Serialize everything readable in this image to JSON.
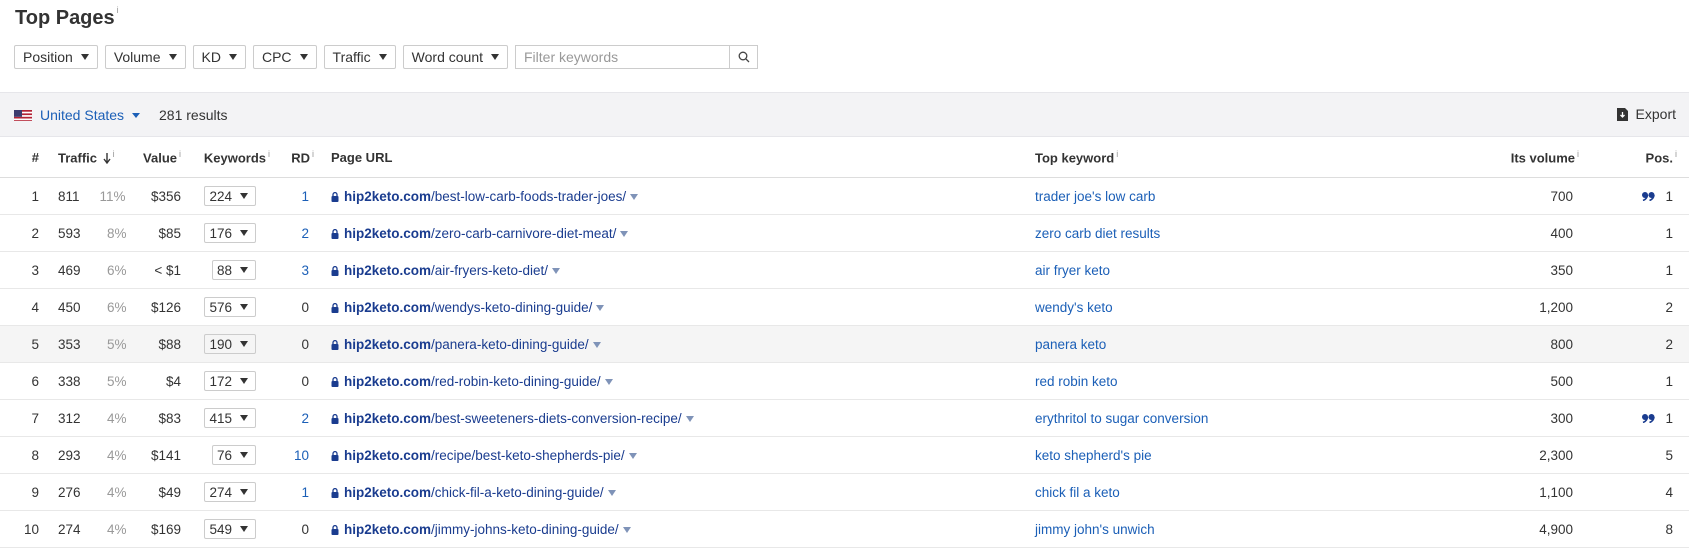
{
  "page": {
    "title": "Top Pages",
    "title_info": "i"
  },
  "filters": {
    "position": "Position",
    "volume": "Volume",
    "kd": "KD",
    "cpc": "CPC",
    "traffic": "Traffic",
    "word_count": "Word count",
    "search_placeholder": "Filter keywords"
  },
  "toolbar": {
    "country": "United States",
    "results": "281 results",
    "export": "Export"
  },
  "columns": {
    "num": "#",
    "traffic": "Traffic",
    "value": "Value",
    "keywords": "Keywords",
    "rd": "RD",
    "page_url": "Page URL",
    "top_keyword": "Top keyword",
    "its_volume": "Its volume",
    "pos": "Pos.",
    "info": "i"
  },
  "rows": [
    {
      "n": "1",
      "traffic": "811",
      "pct": "11%",
      "value": "$356",
      "keywords": "224",
      "rd": "1",
      "domain": "hip2keto.com",
      "path": "/best-low-carb-foods-trader-joes/",
      "top_keyword": "trader joe's low carb",
      "volume": "700",
      "pos": "1",
      "featured": true
    },
    {
      "n": "2",
      "traffic": "593",
      "pct": "8%",
      "value": "$85",
      "keywords": "176",
      "rd": "2",
      "domain": "hip2keto.com",
      "path": "/zero-carb-carnivore-diet-meat/",
      "top_keyword": "zero carb diet results",
      "volume": "400",
      "pos": "1",
      "featured": false
    },
    {
      "n": "3",
      "traffic": "469",
      "pct": "6%",
      "value": "< $1",
      "keywords": "88",
      "rd": "3",
      "domain": "hip2keto.com",
      "path": "/air-fryers-keto-diet/",
      "top_keyword": "air fryer keto",
      "volume": "350",
      "pos": "1",
      "featured": false
    },
    {
      "n": "4",
      "traffic": "450",
      "pct": "6%",
      "value": "$126",
      "keywords": "576",
      "rd": "0",
      "domain": "hip2keto.com",
      "path": "/wendys-keto-dining-guide/",
      "top_keyword": "wendy's keto",
      "volume": "1,200",
      "pos": "2",
      "featured": false
    },
    {
      "n": "5",
      "traffic": "353",
      "pct": "5%",
      "value": "$88",
      "keywords": "190",
      "rd": "0",
      "domain": "hip2keto.com",
      "path": "/panera-keto-dining-guide/",
      "top_keyword": "panera keto",
      "volume": "800",
      "pos": "2",
      "featured": false
    },
    {
      "n": "6",
      "traffic": "338",
      "pct": "5%",
      "value": "$4",
      "keywords": "172",
      "rd": "0",
      "domain": "hip2keto.com",
      "path": "/red-robin-keto-dining-guide/",
      "top_keyword": "red robin keto",
      "volume": "500",
      "pos": "1",
      "featured": false
    },
    {
      "n": "7",
      "traffic": "312",
      "pct": "4%",
      "value": "$83",
      "keywords": "415",
      "rd": "2",
      "domain": "hip2keto.com",
      "path": "/best-sweeteners-diets-conversion-recipe/",
      "top_keyword": "erythritol to sugar conversion",
      "volume": "300",
      "pos": "1",
      "featured": true
    },
    {
      "n": "8",
      "traffic": "293",
      "pct": "4%",
      "value": "$141",
      "keywords": "76",
      "rd": "10",
      "domain": "hip2keto.com",
      "path": "/recipe/best-keto-shepherds-pie/",
      "top_keyword": "keto shepherd's pie",
      "volume": "2,300",
      "pos": "5",
      "featured": false
    },
    {
      "n": "9",
      "traffic": "276",
      "pct": "4%",
      "value": "$49",
      "keywords": "274",
      "rd": "1",
      "domain": "hip2keto.com",
      "path": "/chick-fil-a-keto-dining-guide/",
      "top_keyword": "chick fil a keto",
      "volume": "1,100",
      "pos": "4",
      "featured": false
    },
    {
      "n": "10",
      "traffic": "274",
      "pct": "4%",
      "value": "$169",
      "keywords": "549",
      "rd": "0",
      "domain": "hip2keto.com",
      "path": "/jimmy-johns-keto-dining-guide/",
      "top_keyword": "jimmy john's unwich",
      "volume": "4,900",
      "pos": "8",
      "featured": false
    }
  ],
  "colors": {
    "link": "#1b5fb7",
    "domain": "#1a3c8f",
    "muted": "#999999",
    "bar_bg": "#f3f3f5"
  }
}
